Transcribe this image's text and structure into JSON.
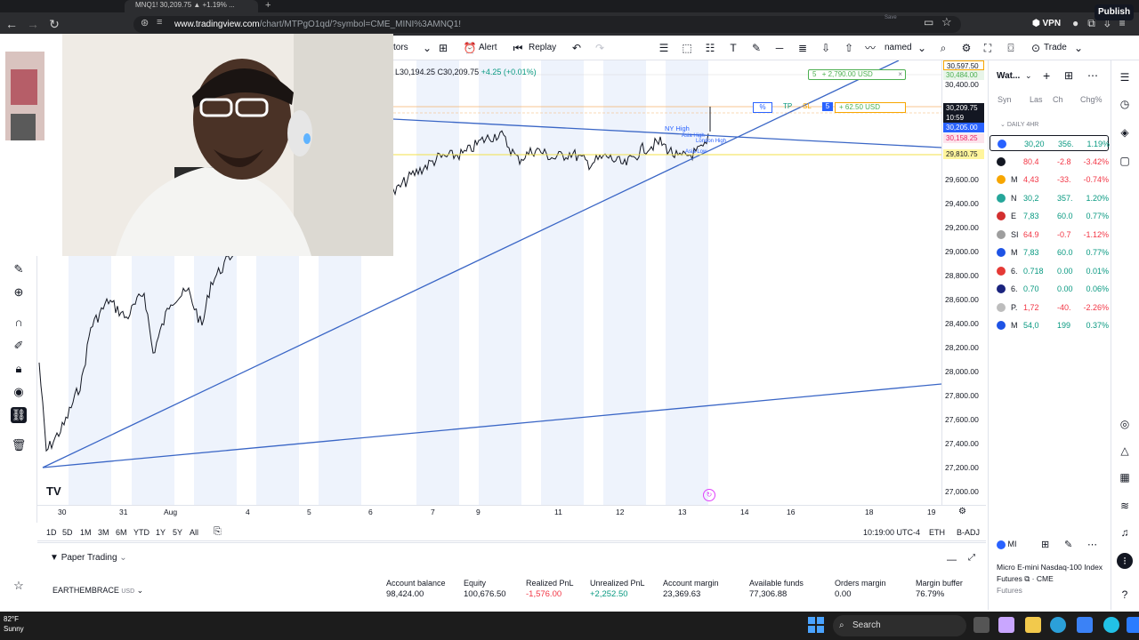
{
  "browser": {
    "tab_title": "MNQ1! 30,209.75 ▲ +1.19% ...",
    "new_tab": "+",
    "url_domain": "www.tradingview.com",
    "url_path": "/chart/MTPgO1qd/?symbol=CME_MINI%3AMNQ1!",
    "vpn_label": "VPN"
  },
  "toolbar": {
    "indicators_label": "tors",
    "alert_label": "Alert",
    "replay_label": "Replay",
    "layout_name": "named",
    "layout_sub": "Save",
    "trade_label": "Trade",
    "publish_label": "Publish"
  },
  "ohlc": {
    "text": "L30,194.25  C30,209.75",
    "change": "+4.25 (+0.01%)"
  },
  "chart": {
    "price_labels": [
      "30,400.00",
      "29,600.00",
      "29,400.00",
      "29,200.00",
      "29,000.00",
      "28,800.00",
      "28,600.00",
      "28,400.00",
      "28,200.00",
      "28,000.00",
      "27,800.00",
      "27,600.00",
      "27,400.00",
      "27,200.00",
      "27,000.00"
    ],
    "tag_top1": "30,597.50",
    "tag_top2": "30,484.00",
    "tag_last": "30,209.75",
    "tag_countdown": "10:59",
    "tag_bid": "30,205.00",
    "tag_pink": "30,158.25",
    "tag_yellow": "29,810.75",
    "time_labels": [
      "30",
      "31",
      "Aug",
      "4",
      "5",
      "6",
      "7",
      "9",
      "11",
      "12",
      "13",
      "14",
      "16",
      "18",
      "19"
    ],
    "order_top": "+ 2,790.00 USD",
    "order_top_qty": "5",
    "order_tp_pct": "%",
    "order_tp": "TP",
    "order_sl": "SL",
    "order_qty": "5",
    "order_value": "+ 62.50 USD",
    "label_ny_high": "NY High",
    "label_asia_high": "Asia High",
    "label_london_high": "London High",
    "label_asia_low": "Asia Low"
  },
  "range": {
    "buttons": [
      "1D",
      "5D",
      "1M",
      "3M",
      "6M",
      "YTD",
      "1Y",
      "5Y",
      "All"
    ],
    "clock": "10:19:00 UTC-4",
    "session": "ETH",
    "adj": "B-ADJ"
  },
  "paper": {
    "tab_label": "Paper Trading",
    "account": "EARTHEMBRACE",
    "account_ccy": "USD",
    "stats": [
      {
        "label": "Account balance",
        "value": "98,424.00"
      },
      {
        "label": "Equity",
        "value": "100,676.50"
      },
      {
        "label": "Realized PnL",
        "value": "-1,576.00"
      },
      {
        "label": "Unrealized PnL",
        "value": "+2,252.50"
      },
      {
        "label": "Account margin",
        "value": "23,369.63"
      },
      {
        "label": "Available funds",
        "value": "77,306.88"
      },
      {
        "label": "Orders margin",
        "value": "0.00"
      },
      {
        "label": "Margin buffer",
        "value": "76.79%"
      }
    ]
  },
  "watchlist": {
    "title": "Wat...",
    "col_sym": "Syn",
    "col_last": "Las",
    "col_ch": "Ch",
    "col_pct": "Chg%",
    "section": "DAILY 4HR",
    "rows": [
      {
        "sym": "",
        "last": "30,20",
        "ch": "356.",
        "pct": "1.19%",
        "color": "#2962ff",
        "dir": "pos"
      },
      {
        "sym": "",
        "last": "80.4",
        "ch": "-2.8",
        "pct": "-3.42%",
        "color": "#131722",
        "dir": "neg"
      },
      {
        "sym": "M",
        "last": "4,43",
        "ch": "-33.",
        "pct": "-0.74%",
        "color": "#f7a600",
        "dir": "neg"
      },
      {
        "sym": "N",
        "last": "30,2",
        "ch": "357.",
        "pct": "1.20%",
        "color": "#26a69a",
        "dir": "pos"
      },
      {
        "sym": "E",
        "last": "7,83",
        "ch": "60.0",
        "pct": "0.77%",
        "color": "#d32f2f",
        "dir": "pos"
      },
      {
        "sym": "SI",
        "last": "64.9",
        "ch": "-0.7",
        "pct": "-1.12%",
        "color": "#9e9e9e",
        "dir": "neg"
      },
      {
        "sym": "M",
        "last": "7,83",
        "ch": "60.0",
        "pct": "0.77%",
        "color": "#1e53e5",
        "dir": "pos"
      },
      {
        "sym": "6.",
        "last": "0.718",
        "ch": "0.00",
        "pct": "0.01%",
        "color": "#e53935",
        "dir": "pos"
      },
      {
        "sym": "6.",
        "last": "0.70",
        "ch": "0.00",
        "pct": "0.06%",
        "color": "#1a237e",
        "dir": "pos"
      },
      {
        "sym": "P.",
        "last": "1,72",
        "ch": "-40.",
        "pct": "-2.26%",
        "color": "#bdbdbd",
        "dir": "neg"
      },
      {
        "sym": "M",
        "last": "54,0",
        "ch": "199",
        "pct": "0.37%",
        "color": "#1e53e5",
        "dir": "pos"
      }
    ],
    "detail_sym": "MI",
    "detail_name1": "Micro E-mini Nasdaq-100 Index",
    "detail_name2": "Futures",
    "detail_exch": "CME",
    "detail_type": "Futures"
  },
  "taskbar": {
    "temp": "82°F",
    "weather": "Sunny",
    "search": "Search"
  }
}
